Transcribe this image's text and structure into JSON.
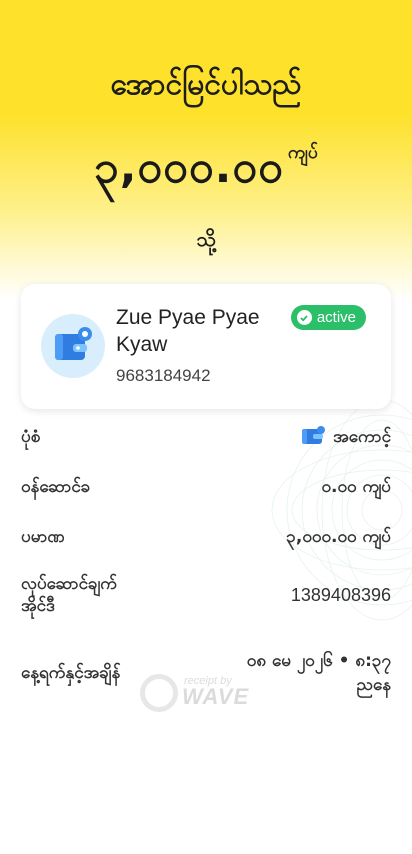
{
  "header": {
    "title": "အောင်မြင်ပါသည်",
    "amount": "၃,၀၀၀.၀၀",
    "currency": "ကျပ်",
    "to_label": "သို့"
  },
  "recipient": {
    "name": "Zue Pyae Pyae Kyaw",
    "phone": "9683184942",
    "status": "active",
    "avatar_icon": "wallet-icon"
  },
  "details": {
    "type_label": "ပုံစံ",
    "type_value": "အကောင့်",
    "fee_label": "ဝန်ဆောင်ခ",
    "fee_value": "၀.၀၀ ကျပ်",
    "amount_label": "ပမာဏ",
    "amount_value": "၃,၀၀၀.၀၀ ကျပ်",
    "txn_label_line1": "လုပ်ဆောင်ချက်",
    "txn_label_line2": "အိုင်ဒီ",
    "txn_value": "1389408396",
    "datetime_label": "နေ့ရက်နှင့်အချိန်",
    "datetime_value_line1": "၀၈ မေ ၂၀၂၆ • ၈:၃၇",
    "datetime_value_line2": "ညနေ"
  },
  "watermark": {
    "small": "receipt by",
    "big": "WAVE"
  },
  "colors": {
    "brand_yellow": "#fde12a",
    "active_green": "#2bbf6a",
    "avatar_bg": "#d8eefc",
    "wallet_blue": "#2f7de1"
  }
}
